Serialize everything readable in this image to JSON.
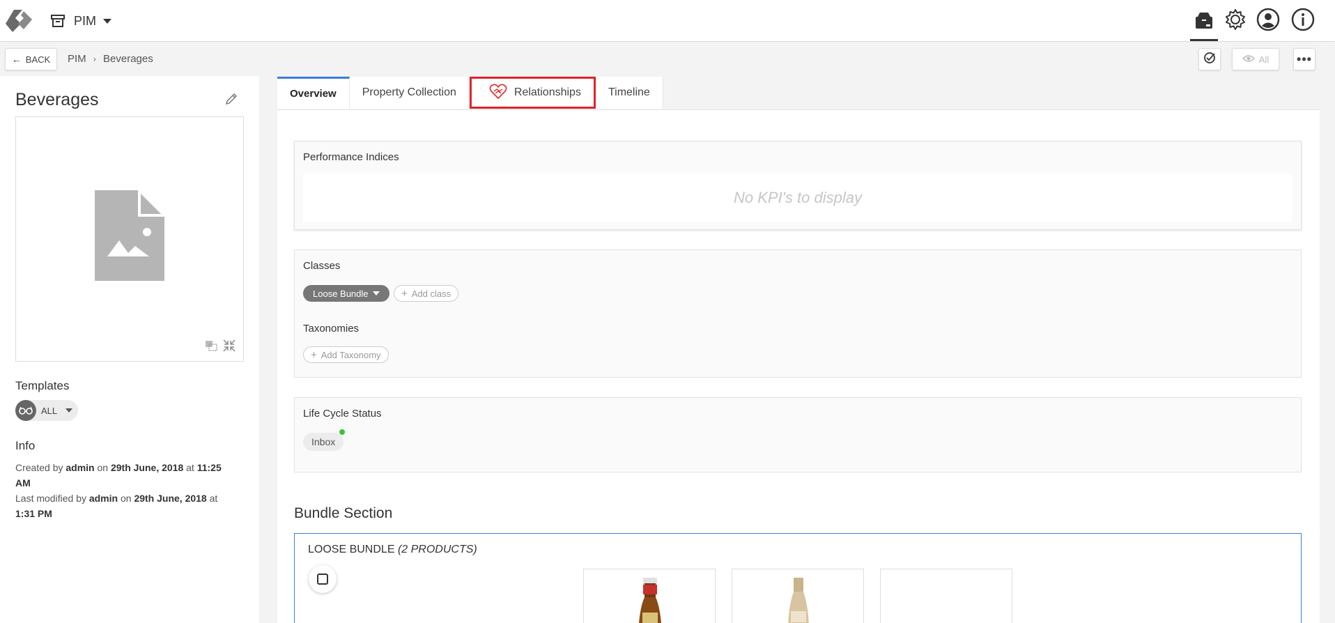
{
  "header": {
    "app_name": "PIM",
    "icons": [
      "app-logo",
      "archive-box-icon",
      "products-icon",
      "gear-icon",
      "user-icon",
      "info-icon"
    ]
  },
  "subheader": {
    "back_label": "BACK",
    "breadcrumb": [
      "PIM",
      "Beverages"
    ],
    "view_label": "All"
  },
  "entity": {
    "title": "Beverages",
    "templates_label": "Templates",
    "template_value": "ALL",
    "info_label": "Info",
    "created_prefix": "Created by",
    "created_user": "admin",
    "created_on": "on",
    "created_date": "29th June, 2018",
    "created_at": "at",
    "created_time": "11:25 AM",
    "modified_prefix": "Last modified by",
    "modified_user": "admin",
    "modified_on": "on",
    "modified_date": "29th June, 2018",
    "modified_at": "at",
    "modified_time": "1:31 PM"
  },
  "tabs": [
    {
      "label": "Overview"
    },
    {
      "label": "Property Collection"
    },
    {
      "label": "Relationships"
    },
    {
      "label": "Timeline"
    }
  ],
  "overview": {
    "kpi_title": "Performance Indices",
    "kpi_empty": "No KPI's to display",
    "classes_title": "Classes",
    "class_chip": "Loose Bundle",
    "add_class": "Add class",
    "taxonomies_title": "Taxonomies",
    "add_taxonomy": "Add Taxonomy",
    "lifecycle_title": "Life Cycle Status",
    "lifecycle_status": "Inbox",
    "bundle_section_title": "Bundle Section",
    "bundle_title": "LOOSE BUNDLE",
    "bundle_count": "(2 PRODUCTS)"
  },
  "colors": {
    "accent": "#3b7dd8",
    "highlight": "#e0242b",
    "status_green": "#3ac142"
  }
}
